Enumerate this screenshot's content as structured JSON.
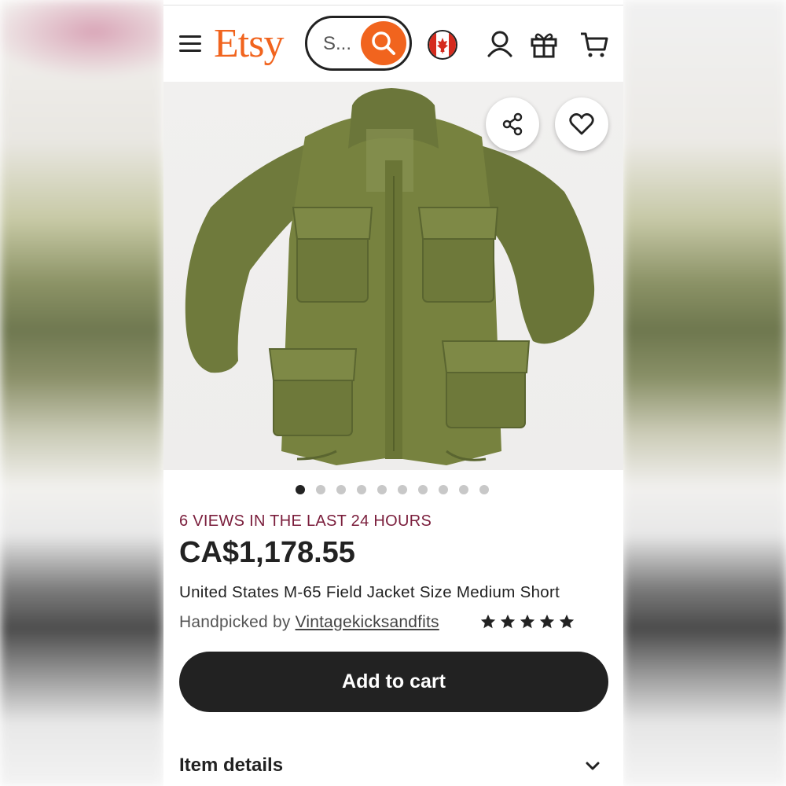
{
  "header": {
    "logo": "Etsy",
    "search_placeholder": "S...",
    "icons": [
      "menu-icon",
      "search-icon",
      "canada-flag-icon",
      "account-icon",
      "gift-icon",
      "cart-icon"
    ]
  },
  "product": {
    "image_icons": [
      "share-icon",
      "heart-icon"
    ],
    "image_count": 10,
    "active_image_index": 0,
    "views_text": "6 VIEWS IN THE LAST 24 HOURS",
    "price": "CA$1,178.55",
    "title": "United States M-65 Field Jacket Size Medium Short",
    "handpicked_prefix": "Handpicked by",
    "seller": "Vintagekicksandfits",
    "rating_stars": 5,
    "add_to_cart": "Add to cart",
    "item_details": "Item details"
  },
  "colors": {
    "brand": "#f1641e",
    "views": "#7a1d3b",
    "button": "#222222"
  }
}
